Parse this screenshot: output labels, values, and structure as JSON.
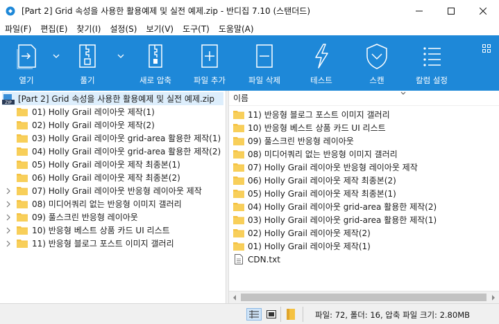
{
  "window": {
    "title": "[Part 2] Grid 속성을 사용한 활용예제 및 실전 예제.zip - 반디집 7.10 (스탠더드)",
    "app_icon": "bandizip-icon",
    "controls": [
      "minimize-icon",
      "maximize-icon",
      "close-icon"
    ]
  },
  "menu": [
    {
      "label": "파일(F)"
    },
    {
      "label": "편집(E)"
    },
    {
      "label": "찾기(I)"
    },
    {
      "label": "설정(S)"
    },
    {
      "label": "보기(V)"
    },
    {
      "label": "도구(T)"
    },
    {
      "label": "도움말(A)"
    }
  ],
  "toolbar": {
    "background": "#1e88d8",
    "open_label": "열기",
    "extract_label": "풀기",
    "new_archive_label": "새로 압축",
    "add_file_label": "파일 추가",
    "delete_file_label": "파일 삭제",
    "test_label": "테스트",
    "scan_label": "스캔",
    "column_settings_label": "칼럼 설정"
  },
  "tree": {
    "root_label": "[Part 2] Grid 속성을 사용한 활용예제 및 실전 예제.zip",
    "items": [
      {
        "label": "01) Holly Grail 레이아웃 제작(1)",
        "expandable": false
      },
      {
        "label": "02) Holly Grail 레이아웃 제작(2)",
        "expandable": false
      },
      {
        "label": "03) Holly Grail 레이아웃 grid-area 활용한 제작(1)",
        "expandable": false
      },
      {
        "label": "04) Holly Grail 레이아웃 grid-area 활용한 제작(2)",
        "expandable": false
      },
      {
        "label": "05) Holly Grail 레이아웃 제작 최종본(1)",
        "expandable": false
      },
      {
        "label": "06) Holly Grail 레이아웃 제작 최종본(2)",
        "expandable": false
      },
      {
        "label": "07) Holly Grail 레이아웃 반응형 레이아웃 제작",
        "expandable": true
      },
      {
        "label": "08) 미디어쿼리 없는 반응형 이미지 갤러리",
        "expandable": true
      },
      {
        "label": "09) 풀스크린 반응형 레이아웃",
        "expandable": true
      },
      {
        "label": "10) 반응형 베스트 상품 카드 UI 리스트",
        "expandable": true
      },
      {
        "label": "11) 반응형 블로그 포스트 이미지 갤러리",
        "expandable": true
      }
    ]
  },
  "list": {
    "column_name": "이름",
    "items": [
      {
        "label": "11) 반응형 블로그 포스트 이미지 갤러리",
        "type": "folder"
      },
      {
        "label": "10) 반응형 베스트 상품 카드 UI 리스트",
        "type": "folder"
      },
      {
        "label": "09) 풀스크린 반응형 레이아웃",
        "type": "folder"
      },
      {
        "label": "08) 미디어쿼리 없는 반응형 이미지 갤러리",
        "type": "folder"
      },
      {
        "label": "07) Holly Grail 레이아웃 반응형 레이아웃 제작",
        "type": "folder"
      },
      {
        "label": "06) Holly Grail 레이아웃 제작 최종본(2)",
        "type": "folder"
      },
      {
        "label": "05) Holly Grail 레이아웃 제작 최종본(1)",
        "type": "folder"
      },
      {
        "label": "04) Holly Grail 레이아웃 grid-area 활용한 제작(2)",
        "type": "folder"
      },
      {
        "label": "03) Holly Grail 레이아웃 grid-area 활용한 제작(1)",
        "type": "folder"
      },
      {
        "label": "02) Holly Grail 레이아웃 제작(2)",
        "type": "folder"
      },
      {
        "label": "01) Holly Grail 레이아웃 제작(1)",
        "type": "folder"
      },
      {
        "label": "CDN.txt",
        "type": "file"
      }
    ]
  },
  "status": {
    "text": "파일: 72, 폴더: 16, 압축 파일 크기: 2.80MB",
    "view_buttons": [
      "details-view-icon",
      "thumbnail-view-icon",
      "folder-view-icon"
    ]
  },
  "colors": {
    "folder": "#f5c242",
    "selection": "#ddeefc",
    "toolbar": "#1e88d8"
  }
}
